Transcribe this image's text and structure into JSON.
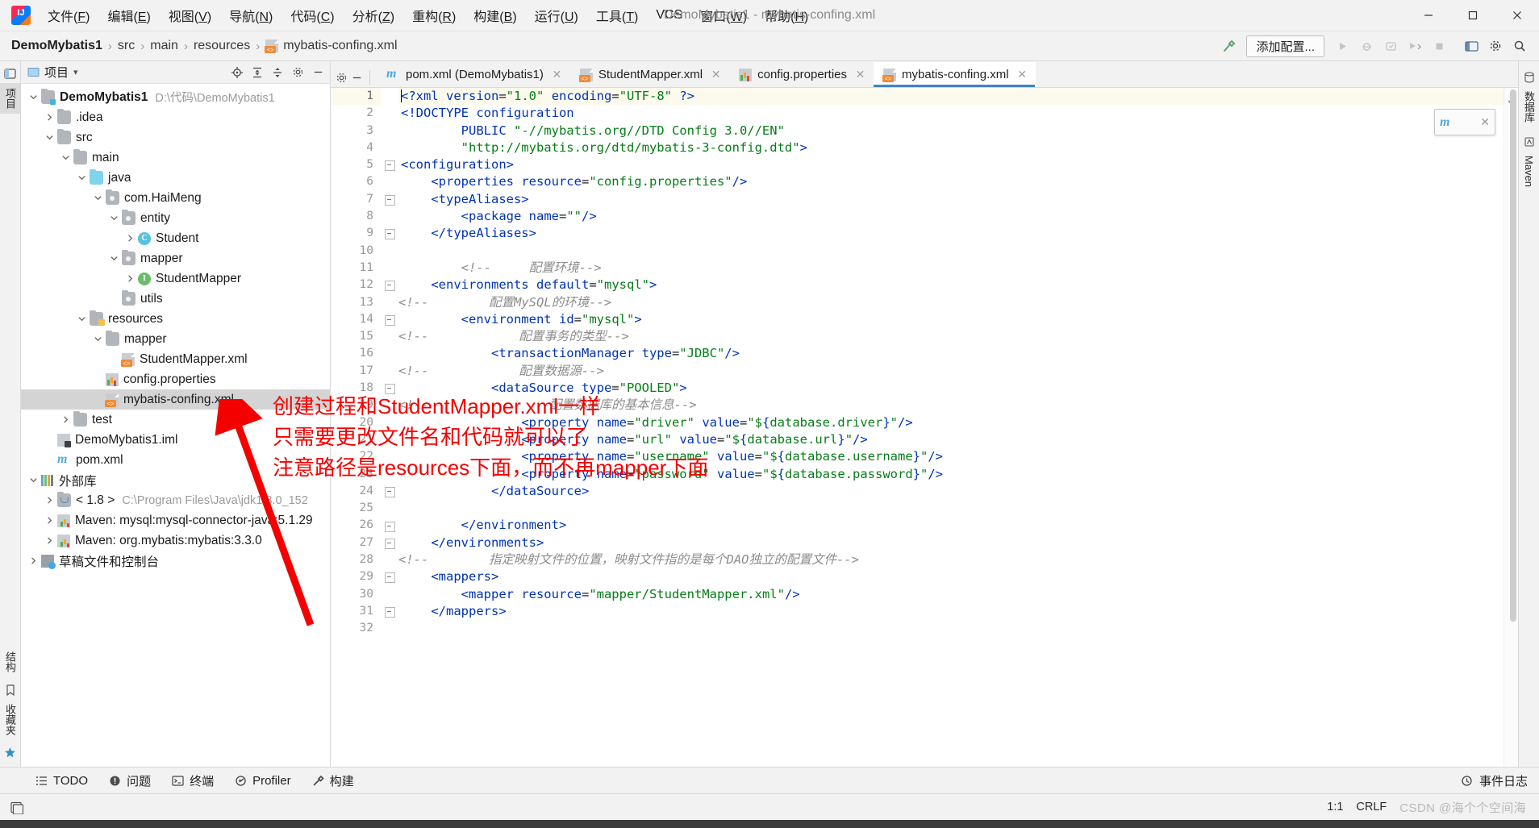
{
  "window": {
    "title": "DemoMybatis1 - mybatis-confing.xml",
    "logo": "intellij-idea-logo",
    "minimize": "─",
    "maximize": "☐",
    "close": "✕"
  },
  "menu": [
    {
      "label": "文件(F)"
    },
    {
      "label": "编辑(E)"
    },
    {
      "label": "视图(V)"
    },
    {
      "label": "导航(N)"
    },
    {
      "label": "代码(C)"
    },
    {
      "label": "分析(Z)"
    },
    {
      "label": "重构(R)"
    },
    {
      "label": "构建(B)"
    },
    {
      "label": "运行(U)"
    },
    {
      "label": "工具(T)"
    },
    {
      "label": "VCS"
    },
    {
      "label": "窗口(W)"
    },
    {
      "label": "帮助(H)"
    }
  ],
  "breadcrumb": {
    "items": [
      "DemoMybatis1",
      "src",
      "main",
      "resources",
      "mybatis-confing.xml"
    ],
    "separator": "›"
  },
  "toolbar": {
    "build_hammer": "build-icon",
    "add_config_label": "添加配置...",
    "run_label": "run-icon",
    "debug_label": "debug-icon",
    "coverage_label": "coverage-icon",
    "profile_label": "profile-icon",
    "stop_label": "stop-icon",
    "layout_label": "layout-icon",
    "settings_label": "settings-icon",
    "search_label": "search-icon"
  },
  "project_panel": {
    "title": "项目",
    "dropdown": "▾",
    "icons": [
      "locate-icon",
      "expand-all-icon",
      "collapse-all-icon",
      "settings-icon",
      "hide-icon"
    ],
    "tree": [
      {
        "depth": 0,
        "arrow": "down",
        "icon": "project-folder",
        "label": "DemoMybatis1",
        "bold": true,
        "path": "D:\\代码\\DemoMybatis1"
      },
      {
        "depth": 1,
        "arrow": "right",
        "icon": "folder",
        "label": ".idea"
      },
      {
        "depth": 1,
        "arrow": "down",
        "icon": "folder",
        "label": "src"
      },
      {
        "depth": 2,
        "arrow": "down",
        "icon": "folder",
        "label": "main"
      },
      {
        "depth": 3,
        "arrow": "down",
        "icon": "folder-blue",
        "label": "java"
      },
      {
        "depth": 4,
        "arrow": "down",
        "icon": "package",
        "label": "com.HaiMeng"
      },
      {
        "depth": 5,
        "arrow": "down",
        "icon": "package",
        "label": "entity"
      },
      {
        "depth": 6,
        "arrow": "right",
        "icon": "class",
        "label": "Student"
      },
      {
        "depth": 5,
        "arrow": "down",
        "icon": "package",
        "label": "mapper"
      },
      {
        "depth": 6,
        "arrow": "right",
        "icon": "interface",
        "label": "StudentMapper"
      },
      {
        "depth": 5,
        "arrow": "none",
        "icon": "package",
        "label": "utils"
      },
      {
        "depth": 3,
        "arrow": "down",
        "icon": "resources-folder",
        "label": "resources"
      },
      {
        "depth": 4,
        "arrow": "down",
        "icon": "folder",
        "label": "mapper"
      },
      {
        "depth": 5,
        "arrow": "none",
        "icon": "xml",
        "label": "StudentMapper.xml"
      },
      {
        "depth": 4,
        "arrow": "none",
        "icon": "properties",
        "label": "config.properties"
      },
      {
        "depth": 4,
        "arrow": "none",
        "icon": "xml",
        "label": "mybatis-confing.xml",
        "selected": true
      },
      {
        "depth": 2,
        "arrow": "right",
        "icon": "folder",
        "label": "test"
      },
      {
        "depth": 1,
        "arrow": "none",
        "icon": "iml",
        "label": "DemoMybatis1.iml"
      },
      {
        "depth": 1,
        "arrow": "none",
        "icon": "maven-m",
        "label": "pom.xml"
      },
      {
        "depth": 0,
        "arrow": "down",
        "icon": "library",
        "label": "外部库"
      },
      {
        "depth": 1,
        "arrow": "right",
        "icon": "jdk",
        "label": "< 1.8 >",
        "path": "C:\\Program Files\\Java\\jdk1.8.0_152"
      },
      {
        "depth": 1,
        "arrow": "right",
        "icon": "maven-lib",
        "label": "Maven: mysql:mysql-connector-java:5.1.29"
      },
      {
        "depth": 1,
        "arrow": "right",
        "icon": "maven-lib",
        "label": "Maven: org.mybatis:mybatis:3.3.0"
      },
      {
        "depth": 0,
        "arrow": "right",
        "icon": "scratch",
        "label": "草稿文件和控制台"
      }
    ]
  },
  "left_strip": {
    "tabs": [
      "项目",
      "结构",
      "收藏夹"
    ],
    "bookmark": "★"
  },
  "right_strip": {
    "tabs": [
      "数据库",
      "Maven"
    ]
  },
  "editor": {
    "tabs": [
      {
        "label": "pom.xml (DemoMybatis1)",
        "icon": "maven-m",
        "active": false,
        "close": "✕"
      },
      {
        "label": "StudentMapper.xml",
        "icon": "xml",
        "active": false,
        "close": "✕"
      },
      {
        "label": "config.properties",
        "icon": "properties",
        "active": false,
        "close": "✕"
      },
      {
        "label": "mybatis-confing.xml",
        "icon": "xml",
        "active": true,
        "close": "✕"
      }
    ],
    "inspection_ok": "✓",
    "popup": {
      "icon": "maven-m",
      "close": "✕"
    },
    "first_line": 1,
    "last_line": 32,
    "lines": [
      {
        "n": 1,
        "current": true,
        "fold": false,
        "caret": true,
        "parts": [
          [
            "tag",
            "<?xml "
          ],
          [
            "attr",
            "version"
          ],
          [
            "plain",
            "="
          ],
          [
            "str",
            "\"1.0\""
          ],
          [
            "plain",
            " "
          ],
          [
            "attr",
            "encoding"
          ],
          [
            "plain",
            "="
          ],
          [
            "str",
            "\"UTF-8\""
          ],
          [
            "tag",
            " ?>"
          ]
        ]
      },
      {
        "n": 2,
        "fold": false,
        "parts": [
          [
            "tag",
            "<!DOCTYPE "
          ],
          [
            "attr",
            "configuration"
          ]
        ]
      },
      {
        "n": 3,
        "fold": false,
        "parts": [
          [
            "plain",
            "        "
          ],
          [
            "attr",
            "PUBLIC "
          ],
          [
            "str",
            "\"-//mybatis.org//DTD Config 3.0//EN\""
          ]
        ]
      },
      {
        "n": 4,
        "fold": false,
        "parts": [
          [
            "plain",
            "        "
          ],
          [
            "str",
            "\"http://mybatis.org/dtd/mybatis-3-config.dtd\""
          ],
          [
            "tag",
            ">"
          ]
        ]
      },
      {
        "n": 5,
        "fold": true,
        "parts": [
          [
            "tag",
            "<configuration>"
          ]
        ]
      },
      {
        "n": 6,
        "fold": false,
        "parts": [
          [
            "plain",
            "    "
          ],
          [
            "tag",
            "<properties "
          ],
          [
            "attr",
            "resource"
          ],
          [
            "plain",
            "="
          ],
          [
            "str",
            "\"config.properties\""
          ],
          [
            "tag",
            "/>"
          ]
        ]
      },
      {
        "n": 7,
        "fold": true,
        "parts": [
          [
            "plain",
            "    "
          ],
          [
            "tag",
            "<typeAliases>"
          ]
        ]
      },
      {
        "n": 8,
        "fold": false,
        "parts": [
          [
            "plain",
            "        "
          ],
          [
            "tag",
            "<package "
          ],
          [
            "attr",
            "name"
          ],
          [
            "plain",
            "="
          ],
          [
            "str",
            "\"\""
          ],
          [
            "tag",
            "/>"
          ]
        ]
      },
      {
        "n": 9,
        "fold": true,
        "parts": [
          [
            "plain",
            "    "
          ],
          [
            "tag",
            "</typeAliases>"
          ]
        ]
      },
      {
        "n": 10,
        "fold": false,
        "parts": [
          [
            "plain",
            ""
          ]
        ]
      },
      {
        "n": 11,
        "fold": false,
        "parts": [
          [
            "plain",
            "        "
          ],
          [
            "cmt",
            "<!--     配置环境-->"
          ]
        ]
      },
      {
        "n": 12,
        "fold": true,
        "parts": [
          [
            "plain",
            "    "
          ],
          [
            "tag",
            "<environments "
          ],
          [
            "attr",
            "default"
          ],
          [
            "plain",
            "="
          ],
          [
            "str",
            "\"mysql\""
          ],
          [
            "tag",
            ">"
          ]
        ]
      },
      {
        "n": 13,
        "fold": false,
        "outdent": true,
        "parts": [
          [
            "cmt",
            "<!--        配置MySQL的环境-->"
          ]
        ]
      },
      {
        "n": 14,
        "fold": true,
        "parts": [
          [
            "plain",
            "        "
          ],
          [
            "tag",
            "<environment "
          ],
          [
            "attr",
            "id"
          ],
          [
            "plain",
            "="
          ],
          [
            "str",
            "\"mysql\""
          ],
          [
            "tag",
            ">"
          ]
        ]
      },
      {
        "n": 15,
        "fold": false,
        "outdent": true,
        "parts": [
          [
            "cmt",
            "<!--            配置事务的类型-->"
          ]
        ]
      },
      {
        "n": 16,
        "fold": false,
        "parts": [
          [
            "plain",
            "            "
          ],
          [
            "tag",
            "<transactionManager "
          ],
          [
            "attr",
            "type"
          ],
          [
            "plain",
            "="
          ],
          [
            "str",
            "\"JDBC\""
          ],
          [
            "tag",
            "/>"
          ]
        ]
      },
      {
        "n": 17,
        "fold": false,
        "outdent": true,
        "parts": [
          [
            "cmt",
            "<!--            配置数据源-->"
          ]
        ]
      },
      {
        "n": 18,
        "fold": true,
        "parts": [
          [
            "plain",
            "            "
          ],
          [
            "tag",
            "<dataSource "
          ],
          [
            "attr",
            "type"
          ],
          [
            "plain",
            "="
          ],
          [
            "str",
            "\"POOLED\""
          ],
          [
            "tag",
            ">"
          ]
        ]
      },
      {
        "n": 19,
        "fold": false,
        "outdent": true,
        "parts": [
          [
            "cmt",
            "<!--                配置数据库的基本信息-->"
          ]
        ]
      },
      {
        "n": 20,
        "fold": false,
        "parts": [
          [
            "plain",
            "                "
          ],
          [
            "tag",
            "<property "
          ],
          [
            "attr",
            "name"
          ],
          [
            "plain",
            "="
          ],
          [
            "str",
            "\"driver\""
          ],
          [
            "plain",
            " "
          ],
          [
            "attr",
            "value"
          ],
          [
            "plain",
            "="
          ],
          [
            "str",
            "\"$"
          ],
          [
            "tag",
            "{"
          ],
          [
            "str",
            "database.driver"
          ],
          [
            "tag",
            "}"
          ],
          [
            "str",
            "\""
          ],
          [
            "tag",
            "/>"
          ]
        ]
      },
      {
        "n": 21,
        "fold": false,
        "parts": [
          [
            "plain",
            "                "
          ],
          [
            "tag",
            "<property "
          ],
          [
            "attr",
            "name"
          ],
          [
            "plain",
            "="
          ],
          [
            "str",
            "\"url\""
          ],
          [
            "plain",
            " "
          ],
          [
            "attr",
            "value"
          ],
          [
            "plain",
            "="
          ],
          [
            "str",
            "\"$"
          ],
          [
            "tag",
            "{"
          ],
          [
            "str",
            "database.url"
          ],
          [
            "tag",
            "}"
          ],
          [
            "str",
            "\""
          ],
          [
            "tag",
            "/>"
          ]
        ]
      },
      {
        "n": 22,
        "fold": false,
        "parts": [
          [
            "plain",
            "                "
          ],
          [
            "tag",
            "<property "
          ],
          [
            "attr",
            "name"
          ],
          [
            "plain",
            "="
          ],
          [
            "str",
            "\"username\""
          ],
          [
            "plain",
            " "
          ],
          [
            "attr",
            "value"
          ],
          [
            "plain",
            "="
          ],
          [
            "str",
            "\"$"
          ],
          [
            "tag",
            "{"
          ],
          [
            "str",
            "database.username"
          ],
          [
            "tag",
            "}"
          ],
          [
            "str",
            "\""
          ],
          [
            "tag",
            "/>"
          ]
        ]
      },
      {
        "n": 23,
        "fold": false,
        "parts": [
          [
            "plain",
            "                "
          ],
          [
            "tag",
            "<property "
          ],
          [
            "attr",
            "name"
          ],
          [
            "plain",
            "="
          ],
          [
            "str",
            "\"password\""
          ],
          [
            "plain",
            " "
          ],
          [
            "attr",
            "value"
          ],
          [
            "plain",
            "="
          ],
          [
            "str",
            "\"$"
          ],
          [
            "tag",
            "{"
          ],
          [
            "str",
            "database.password"
          ],
          [
            "tag",
            "}"
          ],
          [
            "str",
            "\""
          ],
          [
            "tag",
            "/>"
          ]
        ]
      },
      {
        "n": 24,
        "fold": true,
        "parts": [
          [
            "plain",
            "            "
          ],
          [
            "tag",
            "</dataSource>"
          ]
        ]
      },
      {
        "n": 25,
        "fold": false,
        "parts": [
          [
            "plain",
            ""
          ]
        ]
      },
      {
        "n": 26,
        "fold": true,
        "parts": [
          [
            "plain",
            "        "
          ],
          [
            "tag",
            "</environment>"
          ]
        ]
      },
      {
        "n": 27,
        "fold": true,
        "parts": [
          [
            "plain",
            "    "
          ],
          [
            "tag",
            "</environments>"
          ]
        ]
      },
      {
        "n": 28,
        "fold": false,
        "outdent": true,
        "parts": [
          [
            "cmt",
            "<!--        指定映射文件的位置，映射文件指的是每个DAO独立的配置文件-->"
          ]
        ]
      },
      {
        "n": 29,
        "fold": true,
        "parts": [
          [
            "plain",
            "    "
          ],
          [
            "tag",
            "<mappers>"
          ]
        ]
      },
      {
        "n": 30,
        "fold": false,
        "parts": [
          [
            "plain",
            "        "
          ],
          [
            "tag",
            "<mapper "
          ],
          [
            "attr",
            "resource"
          ],
          [
            "plain",
            "="
          ],
          [
            "str",
            "\"mapper/StudentMapper.xml\""
          ],
          [
            "tag",
            "/>"
          ]
        ]
      },
      {
        "n": 31,
        "fold": true,
        "parts": [
          [
            "plain",
            "    "
          ],
          [
            "tag",
            "</mappers>"
          ]
        ]
      },
      {
        "n": 32,
        "fold": false,
        "parts": [
          [
            "plain",
            ""
          ]
        ]
      }
    ]
  },
  "annotations": {
    "color": "#f40000",
    "lines": [
      "创建过程和StudentMapper.xml一样",
      "只需要更改文件名和代码就可以了",
      "注意路径是resources下面，而不再mapper下面"
    ],
    "arrow": "red-arrow-pointing-to-mybatis-confing-xml"
  },
  "bottom_bar": {
    "buttons": [
      {
        "label": "TODO",
        "icon": "todo-icon"
      },
      {
        "label": "问题",
        "icon": "problems-icon"
      },
      {
        "label": "终端",
        "icon": "terminal-icon"
      },
      {
        "label": "Profiler",
        "icon": "profiler-icon"
      },
      {
        "label": "构建",
        "icon": "build-icon"
      }
    ],
    "right": {
      "label": "事件日志",
      "icon": "event-log-icon"
    }
  },
  "status_bar": {
    "left_icon": "toggle-panels-icon",
    "position": "1:1",
    "line_separator": "CRLF",
    "watermark": "CSDN @海个个空间海"
  }
}
